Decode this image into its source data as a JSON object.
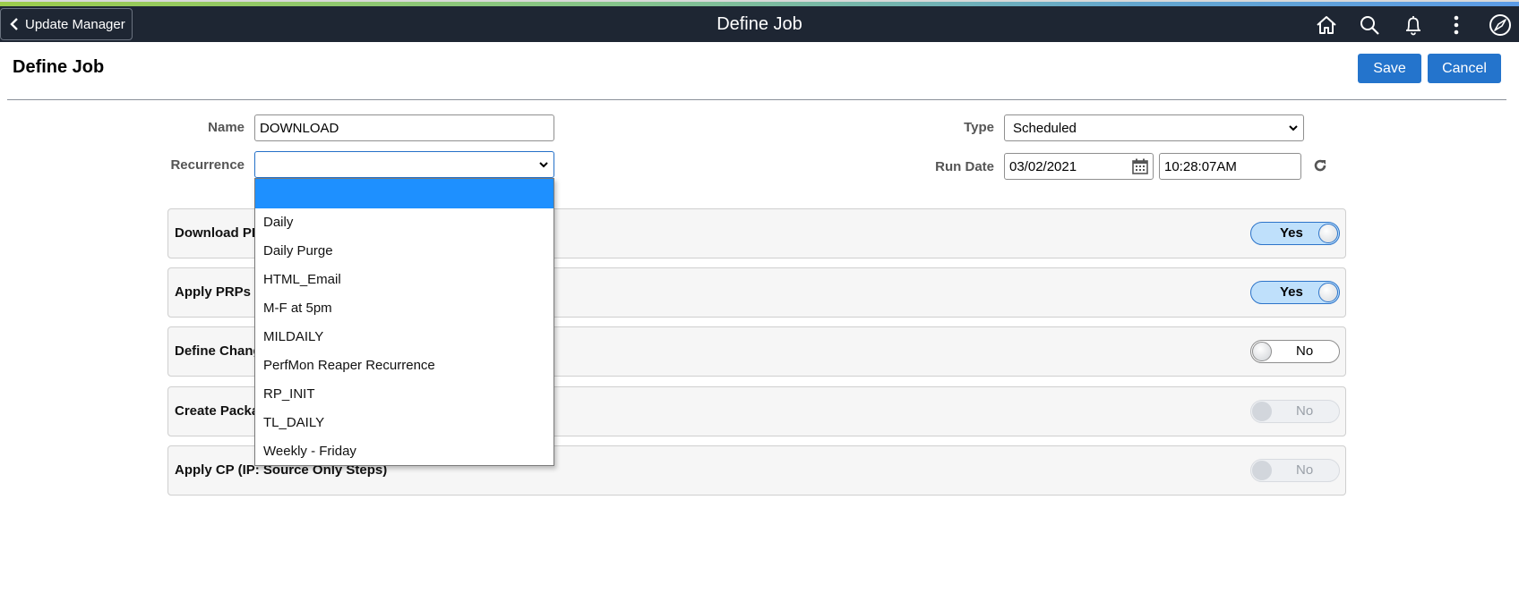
{
  "header": {
    "back_label": "Update Manager",
    "title": "Define Job",
    "icons": [
      "home-icon",
      "search-icon",
      "bell-icon",
      "actions-menu-icon",
      "navbar-compass-icon"
    ]
  },
  "page": {
    "title": "Define Job",
    "save_label": "Save",
    "cancel_label": "Cancel"
  },
  "form": {
    "name_label": "Name",
    "name_value": "DOWNLOAD",
    "recurrence_label": "Recurrence",
    "recurrence_value": "",
    "type_label": "Type",
    "type_value": "Scheduled",
    "run_date_label": "Run Date",
    "run_date_value": "03/02/2021",
    "run_time_value": "10:28:07AM"
  },
  "recurrence_options": [
    "",
    "Daily",
    "Daily Purge",
    "HTML_Email",
    "M-F at 5pm",
    "MILDAILY",
    "PerfMon Reaper Recurrence",
    "RP_INIT",
    "TL_DAILY",
    "Weekly - Friday"
  ],
  "steps": [
    {
      "label": "Download PR",
      "toggle": "Yes",
      "state": "on"
    },
    {
      "label": "Apply PRPs t",
      "toggle": "Yes",
      "state": "on"
    },
    {
      "label": "Define Chang",
      "toggle": "No",
      "state": "off"
    },
    {
      "label": "Create Packa",
      "toggle": "No",
      "state": "disabled"
    },
    {
      "label": "Apply CP (IP: Source Only Steps)",
      "toggle": "No",
      "state": "disabled"
    }
  ],
  "colors": {
    "banner": "#1e2633",
    "primary_button": "#2474cc",
    "dropdown_highlight": "#1e90ff",
    "toggle_on_bg": "#bfe0fb"
  }
}
